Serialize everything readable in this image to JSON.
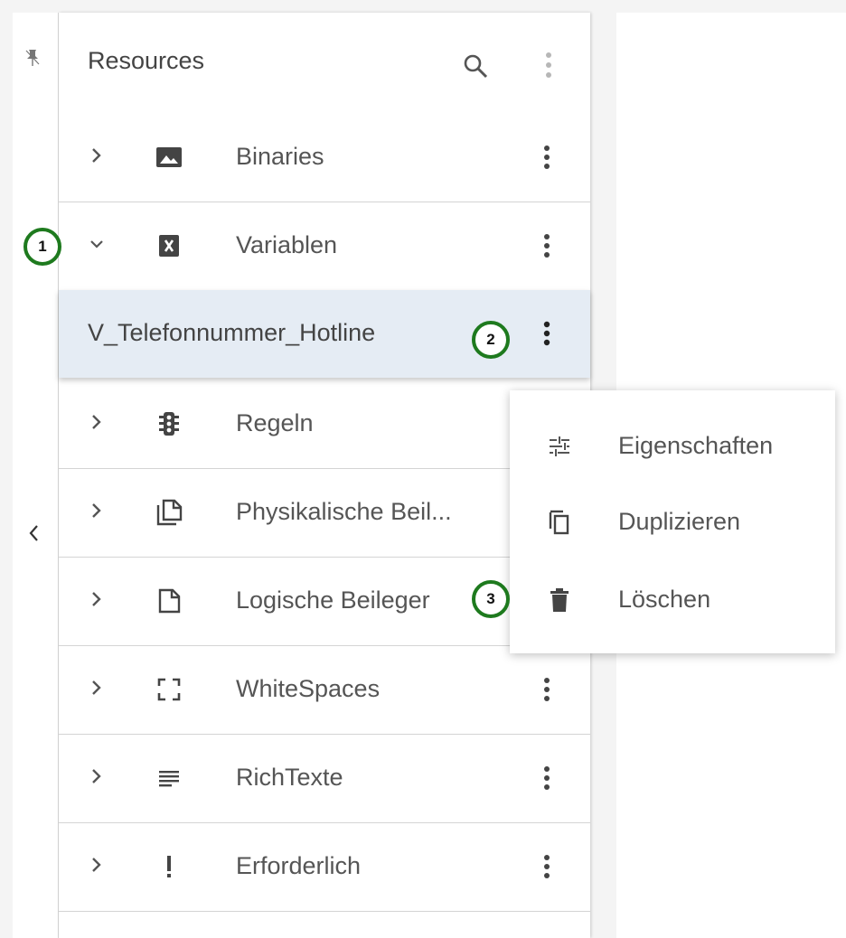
{
  "panel": {
    "title": "Resources",
    "search_icon": "search-icon",
    "menu_icon": "kebab-menu-icon"
  },
  "rail": {
    "pin_icon": "pin-icon",
    "collapse_icon": "chevron-left-icon"
  },
  "tree": {
    "items": [
      {
        "label": "Binaries",
        "icon": "image-icon",
        "expanded": false
      },
      {
        "label": "Variablen",
        "icon": "variable-icon",
        "expanded": true
      },
      {
        "label": "Regeln",
        "icon": "traffic-light-icon",
        "expanded": false
      },
      {
        "label": "Physikalische Beil...",
        "icon": "copy-pages-icon",
        "expanded": false
      },
      {
        "label": "Logische Beileger",
        "icon": "page-icon",
        "expanded": false
      },
      {
        "label": "WhiteSpaces",
        "icon": "frame-corners-icon",
        "expanded": false
      },
      {
        "label": "RichTexte",
        "icon": "text-lines-icon",
        "expanded": false
      },
      {
        "label": "Erforderlich",
        "icon": "exclamation-icon",
        "expanded": false
      }
    ],
    "selected_child": {
      "label": "V_Telefonnummer_Hotline",
      "parent": "Variablen"
    }
  },
  "context_menu": {
    "items": [
      {
        "label": "Eigenschaften",
        "icon": "sliders-icon"
      },
      {
        "label": "Duplizieren",
        "icon": "duplicate-icon"
      },
      {
        "label": "Löschen",
        "icon": "trash-icon"
      }
    ]
  },
  "callouts": [
    "1",
    "2",
    "3"
  ],
  "colors": {
    "selected_row": "#e5ecf4",
    "callout_ring": "#1e7a1e",
    "icon": "#444444"
  }
}
